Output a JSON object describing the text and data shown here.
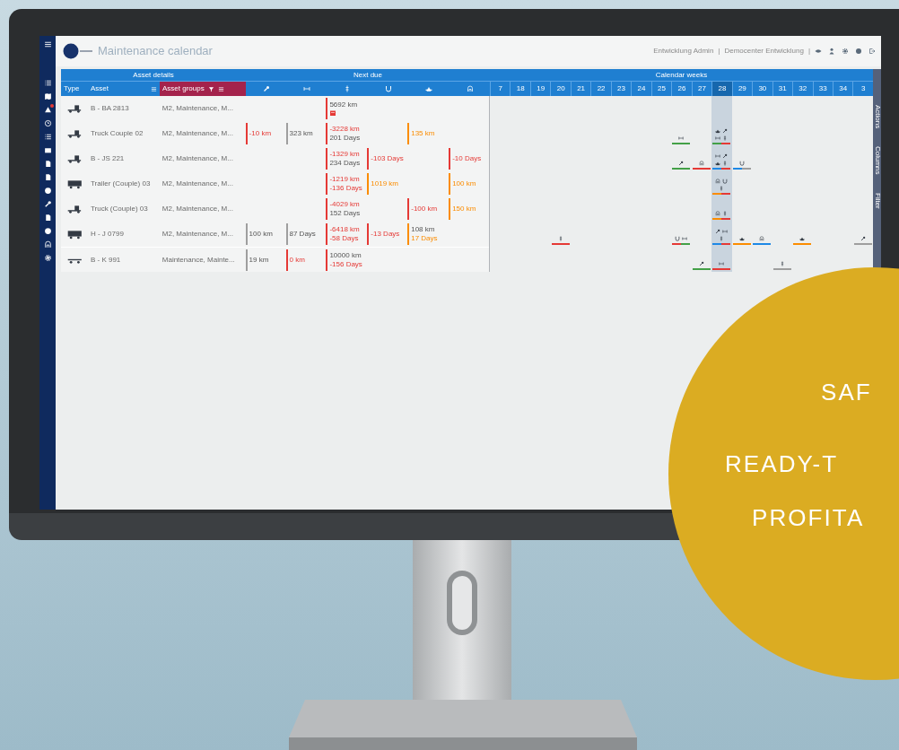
{
  "promo": {
    "lines": [
      "SAF",
      "READY-T",
      "PROFITA"
    ]
  },
  "app": {
    "title": "Maintenance calendar",
    "user": "Entwicklung Admin",
    "separator": "|",
    "tenant": "Democenter Entwicklung",
    "header_icons": [
      {
        "kind": "eye"
      },
      {
        "kind": "person"
      },
      {
        "kind": "gear"
      },
      {
        "kind": "globe"
      },
      {
        "kind": "exit"
      }
    ],
    "sidebar": [
      {
        "kind": "menu",
        "badge": false
      },
      {
        "kind": "list",
        "badge": false
      },
      {
        "kind": "map",
        "badge": false
      },
      {
        "kind": "alert",
        "badge": true
      },
      {
        "kind": "clock",
        "badge": false
      },
      {
        "kind": "list",
        "badge": false
      },
      {
        "kind": "mail",
        "badge": false
      },
      {
        "kind": "doc",
        "badge": false
      },
      {
        "kind": "doc",
        "badge": false
      },
      {
        "kind": "globe",
        "badge": false
      },
      {
        "kind": "wrench",
        "badge": false
      },
      {
        "kind": "doc",
        "badge": false
      },
      {
        "kind": "globe",
        "badge": false
      },
      {
        "kind": "arch",
        "badge": false
      },
      {
        "kind": "gear",
        "badge": false
      }
    ],
    "groups": [
      "Asset details",
      "Next due",
      "Calendar weeks"
    ],
    "columns": [
      {
        "kind": "text",
        "label": "Type",
        "selected": false
      },
      {
        "kind": "text",
        "label": "Asset",
        "selected": false
      },
      {
        "kind": "text",
        "label": "Asset groups",
        "selected": true
      },
      {
        "kind": "wrench",
        "selected": false
      },
      {
        "kind": "axle",
        "selected": false
      },
      {
        "kind": "pin",
        "selected": false
      },
      {
        "kind": "horseshoe",
        "selected": false
      },
      {
        "kind": "boat",
        "selected": false
      },
      {
        "kind": "arch",
        "selected": false
      }
    ],
    "weeks": [
      {
        "label": "7",
        "selected": false
      },
      {
        "label": "18",
        "selected": false
      },
      {
        "label": "19",
        "selected": false
      },
      {
        "label": "20",
        "selected": false
      },
      {
        "label": "21",
        "selected": false
      },
      {
        "label": "22",
        "selected": false
      },
      {
        "label": "23",
        "selected": false
      },
      {
        "label": "24",
        "selected": false
      },
      {
        "label": "25",
        "selected": false
      },
      {
        "label": "26",
        "selected": false
      },
      {
        "label": "27",
        "selected": false
      },
      {
        "label": "28",
        "selected": true
      },
      {
        "label": "29",
        "selected": false
      },
      {
        "label": "30",
        "selected": false
      },
      {
        "label": "31",
        "selected": false
      },
      {
        "label": "32",
        "selected": false
      },
      {
        "label": "33",
        "selected": false
      },
      {
        "label": "34",
        "selected": false
      },
      {
        "label": "3",
        "selected": false
      }
    ],
    "side_tabs": [
      "Actions",
      "Columns",
      "Filter"
    ],
    "rows": [
      {
        "kind": "truck",
        "asset": "B - BA 2813",
        "groups": "M2, Maintenance, M...",
        "due": {
          "pin": {
            "color": "#e53935",
            "lines": [
              {
                "kind": "text",
                "text": "5692 km",
                "overdue": false,
                "warning": false
              },
              {
                "kind": "calendar",
                "overdue": true,
                "warning": false
              }
            ]
          }
        },
        "calendar": {}
      },
      {
        "kind": "truck",
        "asset": "Truck Couple 02",
        "groups": "M2, Maintenance, M...",
        "due": {
          "wrench": {
            "color": "#e53935",
            "lines": [
              {
                "kind": "text",
                "text": "-10 km",
                "overdue": true,
                "warning": false
              }
            ]
          },
          "axle": {
            "color": "#9e9e9e",
            "lines": [
              {
                "kind": "text",
                "text": "323 km",
                "overdue": false,
                "warning": false
              }
            ]
          },
          "pin": {
            "color": "#e53935",
            "lines": [
              {
                "kind": "text",
                "text": "-3228 km",
                "overdue": true,
                "warning": false
              },
              {
                "kind": "text",
                "text": "201 Days",
                "overdue": false,
                "warning": false
              }
            ]
          },
          "boat": {
            "color": "#fb8c00",
            "lines": [
              {
                "kind": "text",
                "text": "135 km",
                "overdue": false,
                "warning": true
              }
            ]
          }
        },
        "calendar": {
          "slot_9": {
            "icons": [
              {
                "kind": "axle"
              }
            ],
            "bars": [
              {
                "color": "#43a047"
              }
            ]
          },
          "slot_11": {
            "icons": [
              {
                "kind": "boat"
              },
              {
                "kind": "wrench"
              },
              {
                "kind": "axle"
              },
              {
                "kind": "pin"
              }
            ],
            "bars": [
              {
                "color": "#43a047"
              },
              {
                "color": "#e53935"
              }
            ]
          }
        }
      },
      {
        "kind": "truck",
        "asset": "B - JS 221",
        "groups": "M2, Maintenance, M...",
        "due": {
          "pin": {
            "color": "#e53935",
            "lines": [
              {
                "kind": "text",
                "text": "-1329 km",
                "overdue": true,
                "warning": false
              },
              {
                "kind": "text",
                "text": "234 Days",
                "overdue": false,
                "warning": false
              }
            ]
          },
          "horseshoe": {
            "color": "#e53935",
            "lines": [
              {
                "kind": "text",
                "text": "-103 Days",
                "overdue": true,
                "warning": false
              }
            ]
          },
          "arch": {
            "color": "#e53935",
            "lines": [
              {
                "kind": "text",
                "text": "-10 Days",
                "overdue": true,
                "warning": false
              }
            ]
          }
        },
        "calendar": {
          "slot_9": {
            "icons": [
              {
                "kind": "wrench"
              }
            ],
            "bars": [
              {
                "color": "#43a047"
              }
            ]
          },
          "slot_10": {
            "icons": [
              {
                "kind": "arch"
              }
            ],
            "bars": [
              {
                "color": "#e53935"
              }
            ]
          },
          "slot_11": {
            "icons": [
              {
                "kind": "axle"
              },
              {
                "kind": "wrench"
              },
              {
                "kind": "boat"
              },
              {
                "kind": "pin"
              }
            ],
            "bars": [
              {
                "color": "#1e88e5"
              },
              {
                "color": "#e53935"
              }
            ]
          },
          "slot_12": {
            "icons": [
              {
                "kind": "horseshoe"
              }
            ],
            "bars": [
              {
                "color": "#1e88e5"
              },
              {
                "color": "#9e9e9e"
              }
            ]
          }
        }
      },
      {
        "kind": "trailer",
        "asset": "Trailer (Couple) 03",
        "groups": "M2, Maintenance, M...",
        "due": {
          "pin": {
            "color": "#e53935",
            "lines": [
              {
                "kind": "text",
                "text": "-1219 km",
                "overdue": true,
                "warning": false
              },
              {
                "kind": "text",
                "text": "-136 Days",
                "overdue": true,
                "warning": false
              }
            ]
          },
          "horseshoe": {
            "color": "#fb8c00",
            "lines": [
              {
                "kind": "text",
                "text": "1019 km",
                "overdue": false,
                "warning": true
              }
            ]
          },
          "arch": {
            "color": "#fb8c00",
            "lines": [
              {
                "kind": "text",
                "text": "100 km",
                "overdue": false,
                "warning": true
              }
            ]
          }
        },
        "calendar": {
          "slot_11": {
            "icons": [
              {
                "kind": "arch"
              },
              {
                "kind": "horseshoe"
              },
              {
                "kind": "pin"
              }
            ],
            "bars": [
              {
                "color": "#fb8c00"
              },
              {
                "color": "#e53935"
              }
            ]
          }
        }
      },
      {
        "kind": "truck",
        "asset": "Truck (Couple) 03",
        "groups": "M2, Maintenance, M...",
        "due": {
          "pin": {
            "color": "#e53935",
            "lines": [
              {
                "kind": "text",
                "text": "-4029 km",
                "overdue": true,
                "warning": false
              },
              {
                "kind": "text",
                "text": "152 Days",
                "overdue": false,
                "warning": false
              }
            ]
          },
          "boat": {
            "color": "#e53935",
            "lines": [
              {
                "kind": "text",
                "text": "-100 km",
                "overdue": true,
                "warning": false
              }
            ]
          },
          "arch": {
            "color": "#fb8c00",
            "lines": [
              {
                "kind": "text",
                "text": "150 km",
                "overdue": false,
                "warning": true
              }
            ]
          }
        },
        "calendar": {
          "slot_11": {
            "icons": [
              {
                "kind": "arch"
              },
              {
                "kind": "pin"
              }
            ],
            "bars": [
              {
                "color": "#fb8c00"
              },
              {
                "color": "#e53935"
              }
            ]
          }
        }
      },
      {
        "kind": "trailer",
        "asset": "H - J 0799",
        "groups": "M2, Maintenance, M...",
        "due": {
          "wrench": {
            "color": "#9e9e9e",
            "lines": [
              {
                "kind": "text",
                "text": "100 km",
                "overdue": false,
                "warning": false
              }
            ]
          },
          "axle": {
            "color": "#9e9e9e",
            "lines": [
              {
                "kind": "text",
                "text": "87 Days",
                "overdue": false,
                "warning": false
              }
            ]
          },
          "pin": {
            "color": "#e53935",
            "lines": [
              {
                "kind": "text",
                "text": "-6418 km",
                "overdue": true,
                "warning": false
              },
              {
                "kind": "text",
                "text": "-58 Days",
                "overdue": true,
                "warning": false
              }
            ]
          },
          "horseshoe": {
            "color": "#e53935",
            "lines": [
              {
                "kind": "text",
                "text": "-13 Days",
                "overdue": true,
                "warning": false
              }
            ]
          },
          "boat": {
            "color": "#fb8c00",
            "lines": [
              {
                "kind": "text",
                "text": "108 km",
                "overdue": false,
                "warning": false
              },
              {
                "kind": "text",
                "text": "17 Days",
                "overdue": false,
                "warning": true
              }
            ]
          }
        },
        "calendar": {
          "slot_3": {
            "icons": [
              {
                "kind": "pin"
              }
            ],
            "bars": [
              {
                "color": "#e53935"
              }
            ]
          },
          "slot_9": {
            "icons": [
              {
                "kind": "horseshoe"
              },
              {
                "kind": "axle"
              }
            ],
            "bars": [
              {
                "color": "#e53935"
              },
              {
                "color": "#43a047"
              }
            ]
          },
          "slot_11": {
            "icons": [
              {
                "kind": "wrench"
              },
              {
                "kind": "axle"
              },
              {
                "kind": "pin"
              }
            ],
            "bars": [
              {
                "color": "#1e88e5"
              },
              {
                "color": "#e53935"
              }
            ]
          },
          "slot_12": {
            "icons": [
              {
                "kind": "boat"
              }
            ],
            "bars": [
              {
                "color": "#fb8c00"
              }
            ]
          },
          "slot_13": {
            "icons": [
              {
                "kind": "arch"
              }
            ],
            "bars": [
              {
                "color": "#1e88e5"
              }
            ]
          },
          "slot_15": {
            "icons": [
              {
                "kind": "boat"
              }
            ],
            "bars": [
              {
                "color": "#fb8c00"
              }
            ]
          },
          "slot_18": {
            "icons": [
              {
                "kind": "wrench"
              }
            ],
            "bars": [
              {
                "color": "#9e9e9e"
              }
            ]
          }
        }
      },
      {
        "kind": "flatbed",
        "asset": "B - K 991",
        "groups": "Maintenance, Mainte...",
        "due": {
          "wrench": {
            "color": "#9e9e9e",
            "lines": [
              {
                "kind": "text",
                "text": "19 km",
                "overdue": false,
                "warning": false
              }
            ]
          },
          "axle": {
            "color": "#e53935",
            "lines": [
              {
                "kind": "text",
                "text": "0 km",
                "overdue": true,
                "warning": false
              }
            ]
          },
          "pin": {
            "color": "#e53935",
            "lines": [
              {
                "kind": "text",
                "text": "10000 km",
                "overdue": false,
                "warning": false
              },
              {
                "kind": "text",
                "text": "-156 Days",
                "overdue": true,
                "warning": false
              }
            ]
          }
        },
        "calendar": {
          "slot_10": {
            "icons": [
              {
                "kind": "wrench"
              }
            ],
            "bars": [
              {
                "color": "#43a047"
              }
            ]
          },
          "slot_11": {
            "icons": [
              {
                "kind": "axle"
              }
            ],
            "bars": [
              {
                "color": "#e53935"
              }
            ]
          },
          "slot_14": {
            "icons": [
              {
                "kind": "pin"
              }
            ],
            "bars": [
              {
                "color": "#9e9e9e"
              }
            ]
          }
        }
      }
    ]
  }
}
